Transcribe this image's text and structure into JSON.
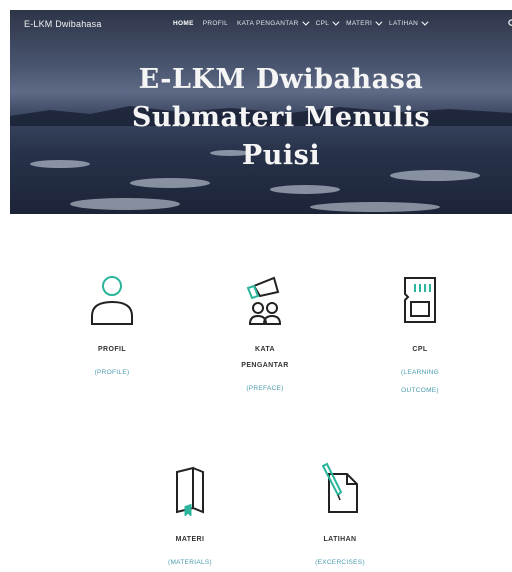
{
  "nav": {
    "brand": "E-LKM Dwibahasa",
    "items": [
      {
        "label": "HOME",
        "active": true,
        "dropdown": false
      },
      {
        "label": "PROFIL",
        "active": false,
        "dropdown": false
      },
      {
        "label": "KATA PENGANTAR",
        "active": false,
        "dropdown": true
      },
      {
        "label": "CPL",
        "active": false,
        "dropdown": true
      },
      {
        "label": "MATERI",
        "active": false,
        "dropdown": true
      },
      {
        "label": "LATIHAN",
        "active": false,
        "dropdown": true
      }
    ]
  },
  "hero": {
    "line1": "E-LKM Dwibahasa",
    "line2": "Submateri Menulis",
    "line3": "Puisi"
  },
  "features": [
    {
      "label": "PROFIL",
      "label2": "",
      "sub": "(PROFILE)",
      "sub2": "",
      "icon": "user-icon"
    },
    {
      "label": "KATA",
      "label2": "PENGANTAR",
      "sub": "(PREFACE)",
      "sub2": "",
      "icon": "audience-icon"
    },
    {
      "label": "CPL",
      "label2": "",
      "sub": "(LEARNING",
      "sub2": "OUTCOME)",
      "icon": "memory-card-icon"
    },
    {
      "label": "MATERI",
      "label2": "",
      "sub": "(MATERIALS)",
      "sub2": "",
      "icon": "book-icon"
    },
    {
      "label": "LATIHAN",
      "label2": "",
      "sub": "(EXCERCISES)",
      "sub2": "",
      "icon": "document-pen-icon"
    }
  ],
  "colors": {
    "accent": "#4a9cb0",
    "icon_teal": "#2bb59a",
    "text": "#333333"
  }
}
